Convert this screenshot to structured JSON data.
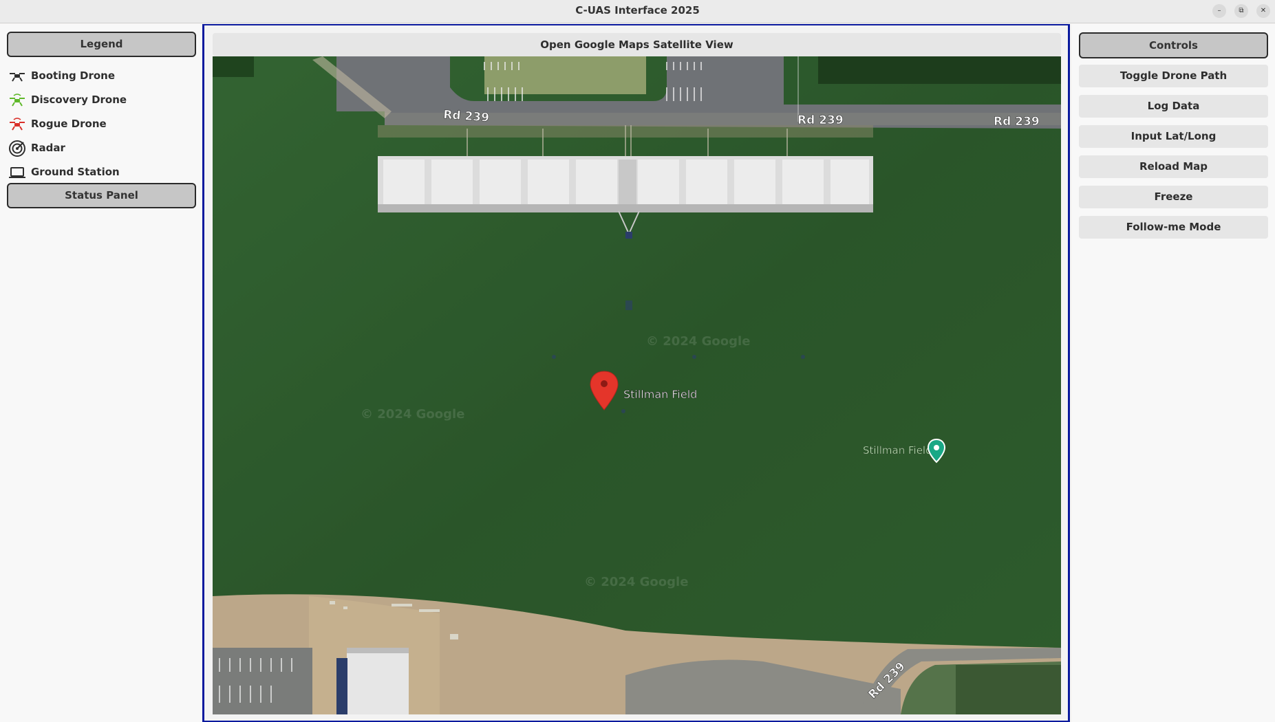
{
  "window": {
    "title": "C-UAS Interface 2025"
  },
  "left_panel": {
    "legend_label": "Legend",
    "legend_items": [
      {
        "label": "Booting Drone",
        "icon": "drone-icon",
        "color": "#2e2e2e"
      },
      {
        "label": "Discovery Drone",
        "icon": "drone-icon",
        "color": "#5fb82a"
      },
      {
        "label": "Rogue Drone",
        "icon": "drone-icon",
        "color": "#d9302a"
      },
      {
        "label": "Radar",
        "icon": "radar-icon",
        "color": "#2e2e2e"
      },
      {
        "label": "Ground Station",
        "icon": "laptop-icon",
        "color": "#2e2e2e"
      }
    ],
    "status_label": "Status Panel"
  },
  "map": {
    "open_button_label": "Open Google Maps Satellite View",
    "road_labels": [
      "Rd 239",
      "Rd 239",
      "Rd 239",
      "Rd 239"
    ],
    "pin_label": "Stillman Field",
    "place_label": "Stillman Field",
    "watermark": "© 2024 Google",
    "colors": {
      "grass": "#2e5a2c",
      "pin": "#e4352a",
      "place_pin": "#19a886"
    }
  },
  "controls": {
    "header": "Controls",
    "buttons": [
      "Toggle Drone Path",
      "Log Data",
      "Input Lat/Long",
      "Reload Map",
      "Freeze",
      "Follow-me Mode"
    ]
  }
}
